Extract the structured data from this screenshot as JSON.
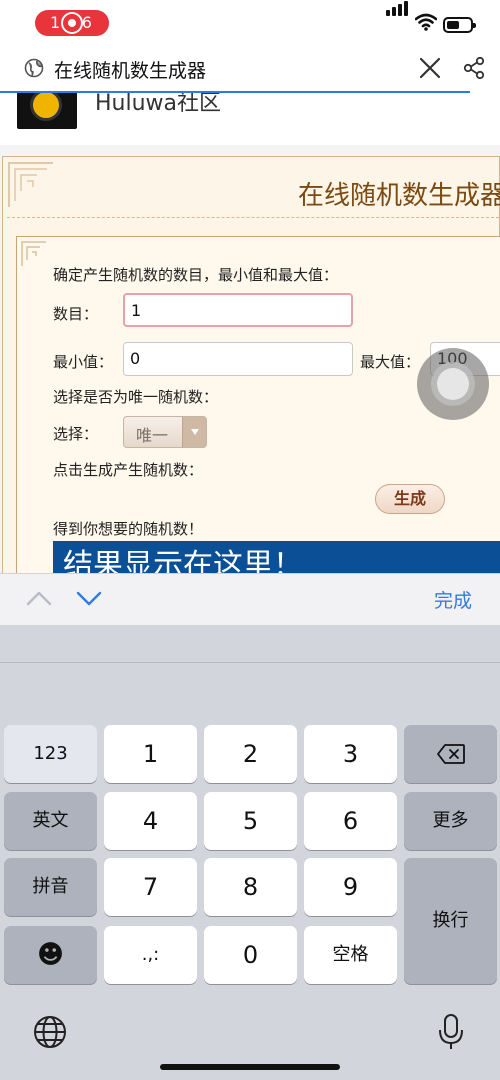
{
  "status_bar": {
    "recording_time": "1:06",
    "battery_level": 0.55
  },
  "browser": {
    "page_title": "在线随机数生成器",
    "load_progress": 0.94
  },
  "site": {
    "name": "Huluwa社区"
  },
  "tool": {
    "title": "在线随机数生成器",
    "instruction": "确定产生随机数的数目，最小值和最大值：",
    "count_label": "数目：",
    "count_value": "1",
    "min_label": "最小值：",
    "min_value": "0",
    "max_label": "最大值：",
    "max_value": "100",
    "unique_prompt": "选择是否为唯一随机数：",
    "select_label": "选择：",
    "select_value": "唯一",
    "generate_prompt": "点击生成产生随机数：",
    "generate_button": "生成",
    "result_prompt": "得到你想要的随机数！",
    "result_text": "结果显示在这里！"
  },
  "accessory": {
    "done_label": "完成"
  },
  "keyboard": {
    "key_123": "123",
    "key_1": "1",
    "key_2": "2",
    "key_3": "3",
    "key_en": "英文",
    "key_4": "4",
    "key_5": "5",
    "key_6": "6",
    "key_more": "更多",
    "key_pinyin": "拼音",
    "key_7": "7",
    "key_8": "8",
    "key_9": "9",
    "key_return": "换行",
    "key_emoji": "☻",
    "key_punct": ".,:",
    "key_0": "0",
    "key_space": "空格"
  },
  "colors": {
    "accent_blue": "#2f7de0",
    "result_bg": "#0b4f96",
    "title_brown": "#7b4a12",
    "record_red": "#e8343a"
  }
}
